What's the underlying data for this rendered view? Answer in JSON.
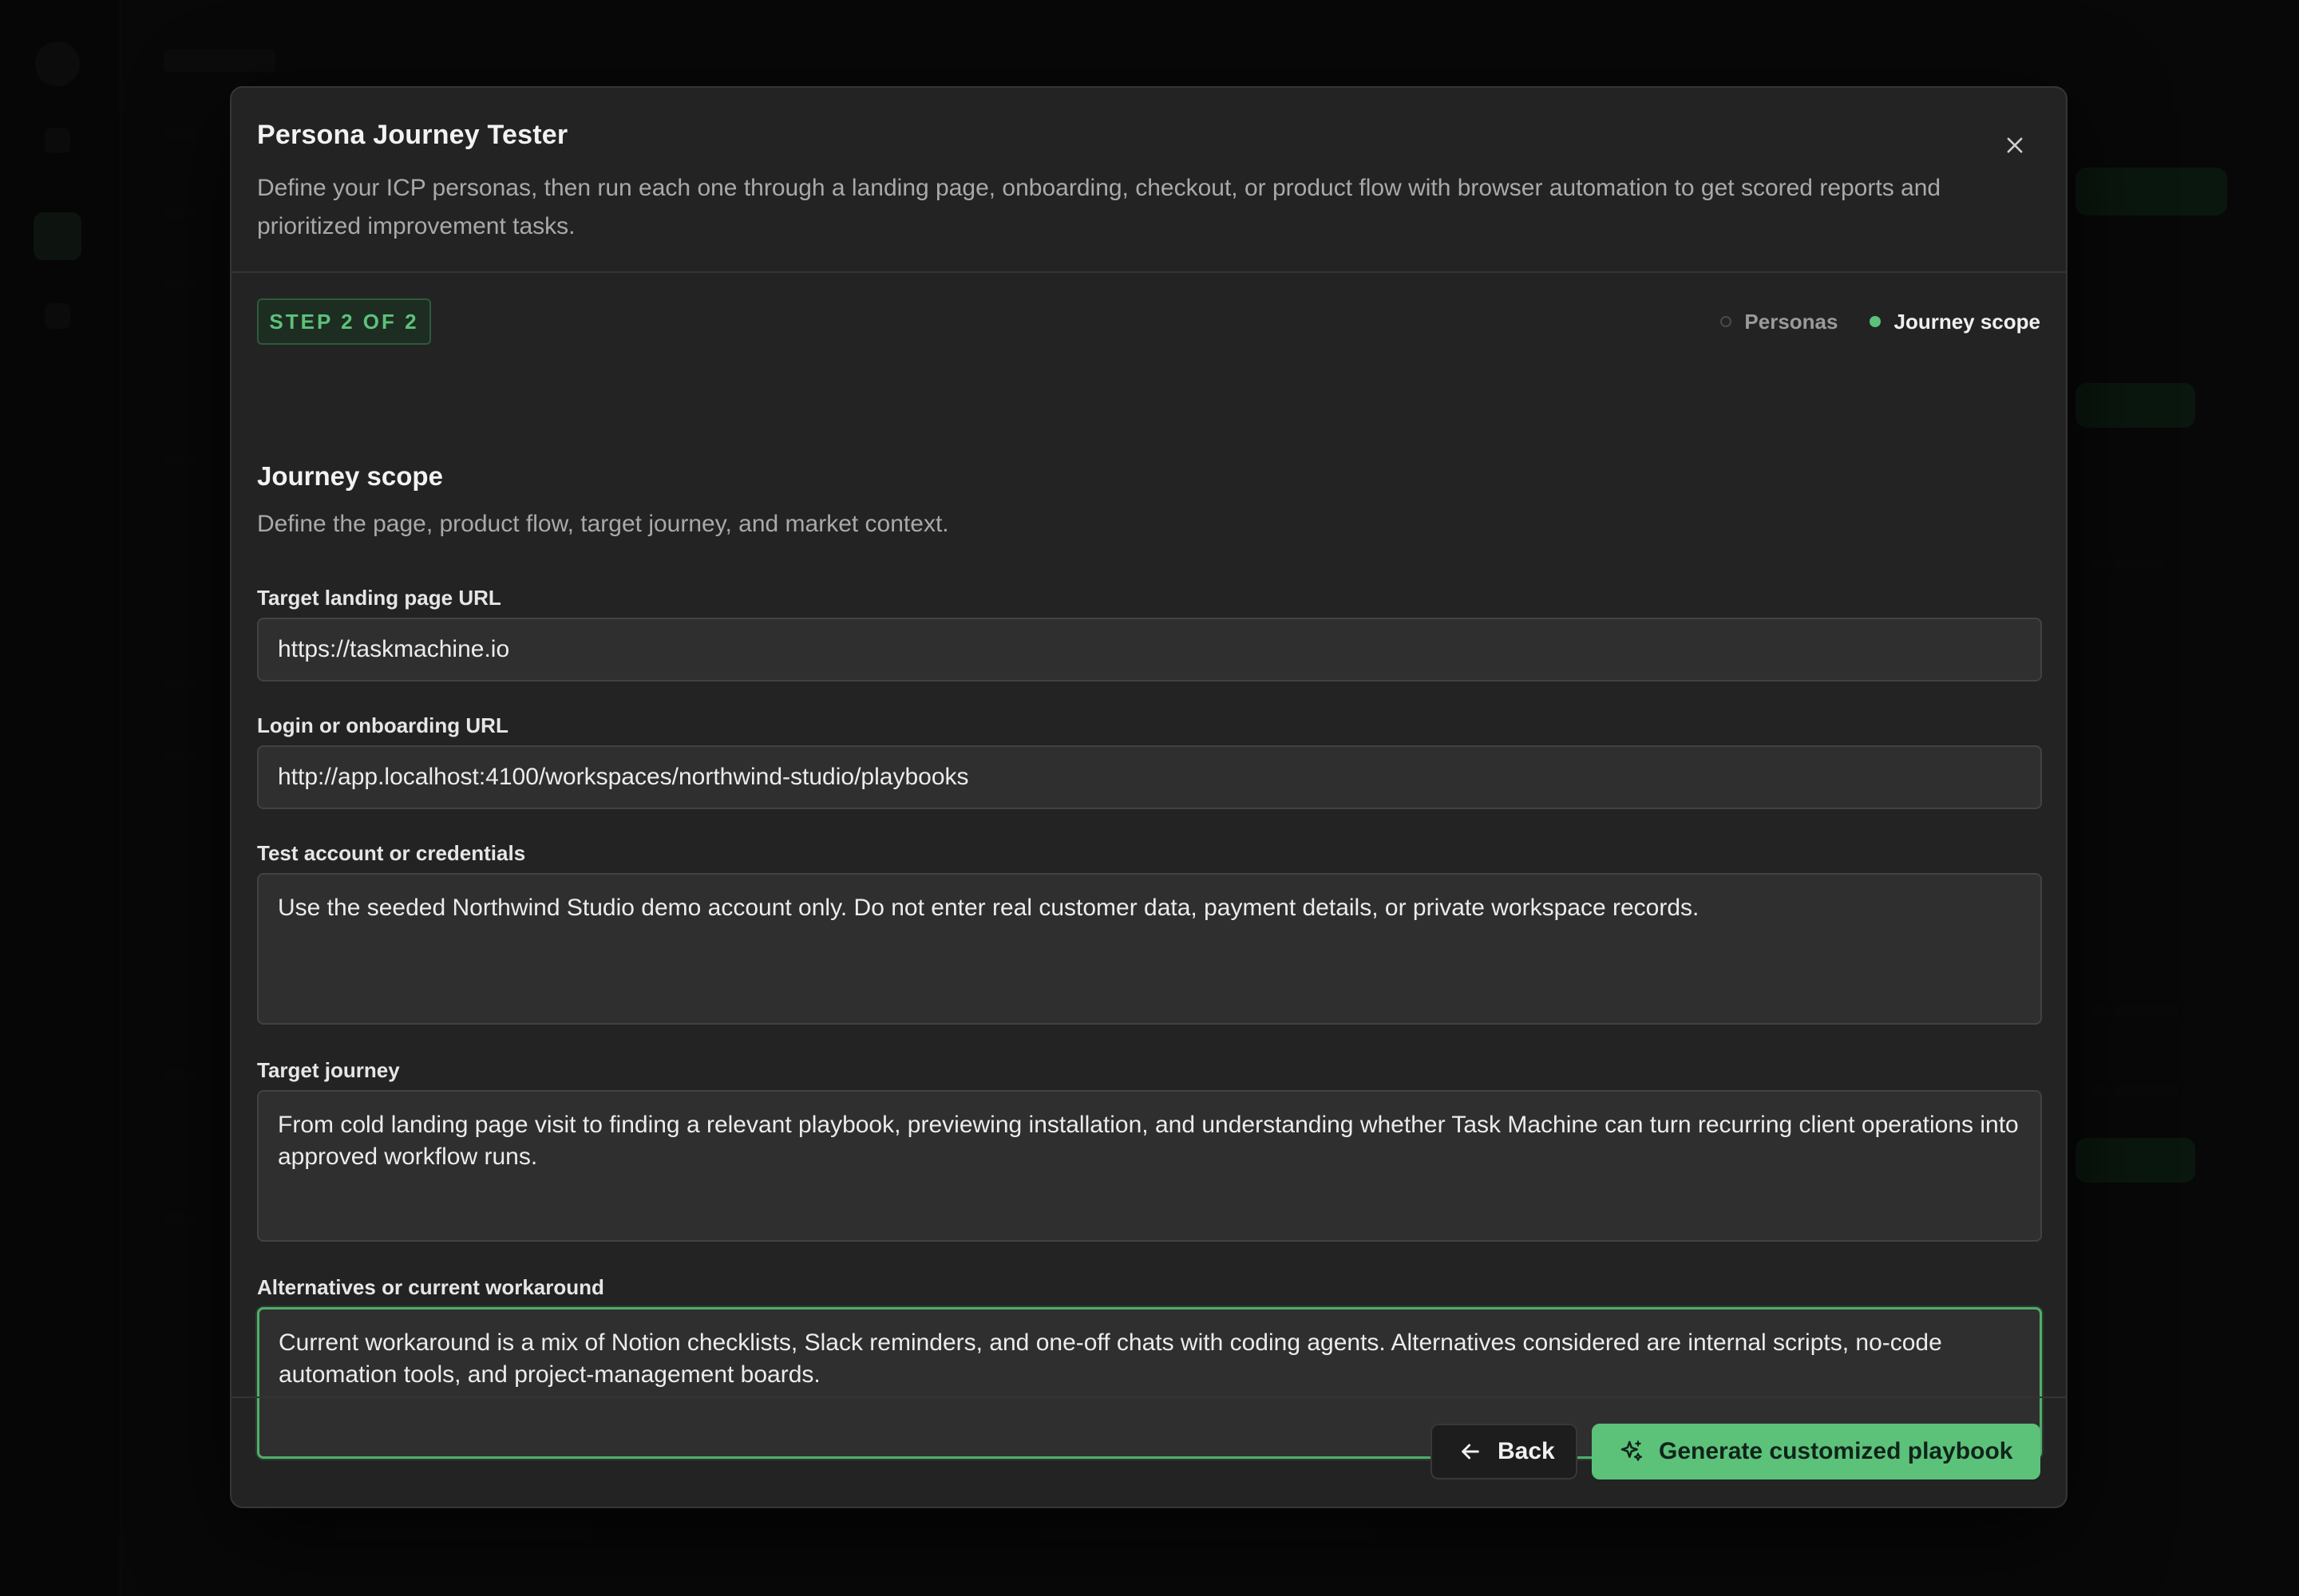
{
  "modal": {
    "title": "Persona Journey Tester",
    "description": "Define your ICP personas, then run each one through a landing page, onboarding, checkout, or product flow with browser automation to get scored reports and prioritized improvement tasks.",
    "close_icon": "close-icon"
  },
  "stepper": {
    "badge": "STEP 2 OF 2",
    "steps": [
      {
        "label": "Personas",
        "active": false
      },
      {
        "label": "Journey scope",
        "active": true
      }
    ]
  },
  "section": {
    "title": "Journey scope",
    "description": "Define the page, product flow, target journey, and market context."
  },
  "fields": {
    "landing_url": {
      "label": "Target landing page URL",
      "value": "https://taskmachine.io"
    },
    "login_url": {
      "label": "Login or onboarding URL",
      "value": "http://app.localhost:4100/workspaces/northwind-studio/playbooks"
    },
    "credentials": {
      "label": "Test account or credentials",
      "value": "Use the seeded Northwind Studio demo account only. Do not enter real customer data, payment details, or private workspace records."
    },
    "target_journey": {
      "label": "Target journey",
      "value": "From cold landing page visit to finding a relevant playbook, previewing installation, and understanding whether Task Machine can turn recurring client operations into approved workflow runs."
    },
    "alternatives": {
      "label": "Alternatives or current workaround",
      "value": "Current workaround is a mix of Notion checklists, Slack reminders, and one-off chats with coding agents. Alternatives considered are internal scripts, no-code automation tools, and project-management boards."
    }
  },
  "footer": {
    "back_label": "Back",
    "back_icon": "arrow-left-icon",
    "generate_label": "Generate customized playbook",
    "generate_icon": "sparkles-icon"
  },
  "colors": {
    "accent": "#5cc27a",
    "modal_bg": "#232323",
    "input_bg": "#2f2f2f",
    "focus_border": "#4fae6a"
  }
}
